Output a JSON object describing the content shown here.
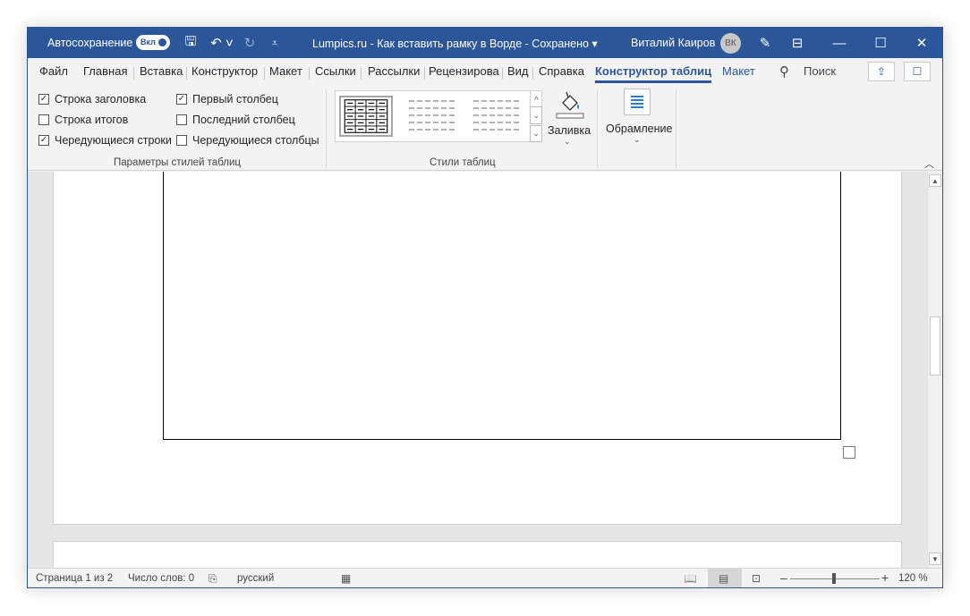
{
  "titlebar": {
    "autosave_label": "Автосохранение",
    "autosave_state": "Вкл",
    "doc_title": "Lumpics.ru - Как вставить рамку в Ворде  -  Сохранено  ▾",
    "user_name": "Виталий Каиров",
    "user_initials": "ВК",
    "save_glyph": "🖫",
    "undo_glyph": "↶ ˅",
    "redo_glyph": "↻",
    "customize_glyph": "⩡",
    "pen_glyph": "✎",
    "ribbon_opts_glyph": "⊟",
    "minimize_glyph": "—",
    "maximize_glyph": "☐",
    "close_glyph": "✕"
  },
  "tabs": [
    {
      "label": "Файл"
    },
    {
      "label": "Главная"
    },
    {
      "label": "Вставка"
    },
    {
      "label": "Конструктор"
    },
    {
      "label": "Макет"
    },
    {
      "label": "Ссылки"
    },
    {
      "label": "Рассылки"
    },
    {
      "label": "Рецензирова"
    },
    {
      "label": "Вид"
    },
    {
      "label": "Справка"
    },
    {
      "label": "Конструктор таблиц"
    },
    {
      "label": "Макет"
    }
  ],
  "search": {
    "label": "Поиск",
    "glyph": "⚲"
  },
  "share_glyph": "⇪",
  "comment_glyph": "☐",
  "ribbon": {
    "style_options": {
      "header_row": {
        "label": "Строка заголовка",
        "checked": "✓"
      },
      "total_row": {
        "label": "Строка итогов",
        "checked": ""
      },
      "banded_rows": {
        "label": "Чередующиеся строки",
        "checked": "✓"
      },
      "first_column": {
        "label": "Первый столбец",
        "checked": "✓"
      },
      "last_column": {
        "label": "Последний столбец",
        "checked": ""
      },
      "banded_columns": {
        "label": "Чередующиеся столбцы",
        "checked": ""
      },
      "group_label": "Параметры стилей таблиц"
    },
    "table_styles": {
      "group_label": "Стили таблиц"
    },
    "shading": {
      "label": "Заливка",
      "caret": "⌄"
    },
    "borders": {
      "label": "Обрамление",
      "caret": "⌄"
    },
    "collapse_glyph": "︿",
    "gallery_up": "˄",
    "gallery_down": "⌄",
    "gallery_more": "⌄"
  },
  "scrollbar": {
    "up": "▲",
    "down": "▼"
  },
  "statusbar": {
    "page": "Страница 1 из 2",
    "words": "Число слов: 0",
    "proofing_glyph": "⎘",
    "language": "русский",
    "macro_glyph": "▦",
    "read_mode_glyph": "📖",
    "print_layout_glyph": "▤",
    "web_layout_glyph": "⊡",
    "zoom_minus": "–",
    "zoom_plus": "+",
    "zoom_level": "120 %",
    "zoom_fraction": 0.49
  }
}
